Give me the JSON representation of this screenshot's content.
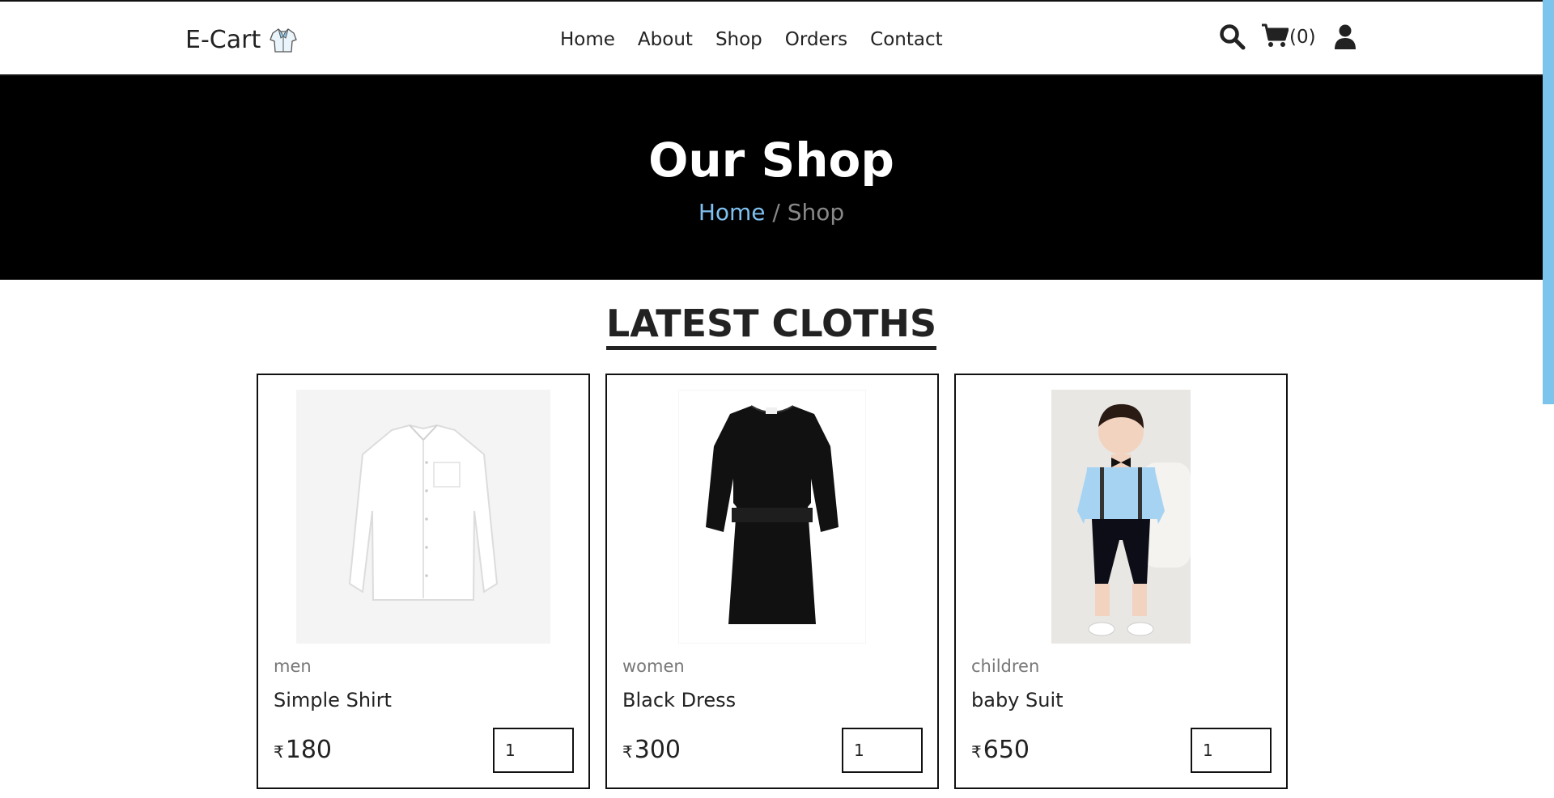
{
  "header": {
    "logo_text": "E-Cart",
    "nav": [
      "Home",
      "About",
      "Shop",
      "Orders",
      "Contact"
    ],
    "cart_count": "(0)"
  },
  "hero": {
    "title": "Our Shop",
    "breadcrumb_home": "Home",
    "breadcrumb_sep": " / ",
    "breadcrumb_current": "Shop"
  },
  "section": {
    "title": "LATEST CLOTHS"
  },
  "products": [
    {
      "category": "men",
      "name": "Simple Shirt",
      "currency": "₹",
      "price": "180",
      "qty": "1"
    },
    {
      "category": "women",
      "name": "Black Dress",
      "currency": "₹",
      "price": "300",
      "qty": "1"
    },
    {
      "category": "children",
      "name": "baby Suit",
      "currency": "₹",
      "price": "650",
      "qty": "1"
    }
  ],
  "colors": {
    "hero_bg": "#000000",
    "breadcrumb_link": "#7fc0f0",
    "scrollbar_thumb": "#7cc4ec"
  }
}
